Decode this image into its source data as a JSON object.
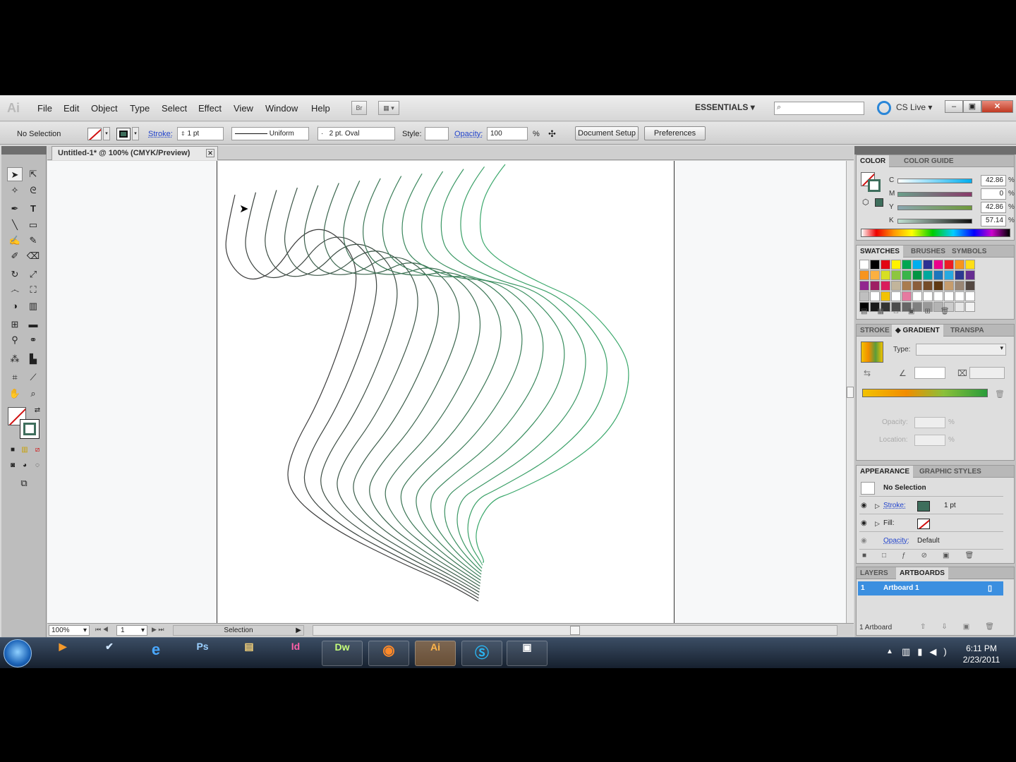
{
  "menubar": {
    "app_logo": "Ai",
    "items": [
      "File",
      "Edit",
      "Object",
      "Type",
      "Select",
      "Effect",
      "View",
      "Window",
      "Help"
    ],
    "bridge_label": "Br",
    "workspace": "ESSENTIALS",
    "cs_live": "CS Live"
  },
  "controlbar": {
    "selection": "No Selection",
    "stroke_label": "Stroke:",
    "stroke_weight": "1 pt",
    "profile": "Uniform",
    "brush": "2 pt. Oval",
    "style_label": "Style:",
    "opacity_label": "Opacity:",
    "opacity_value": "100",
    "opacity_unit": "%",
    "document_setup": "Document Setup",
    "preferences": "Preferences"
  },
  "document": {
    "tab_title": "Untitled-1* @ 100% (CMYK/Preview)",
    "zoom": "100%",
    "artboard_num": "1",
    "status": "Selection"
  },
  "color_panel": {
    "tabs": [
      "COLOR",
      "COLOR GUIDE"
    ],
    "channels": [
      {
        "label": "C",
        "value": "42.86",
        "unit": "%"
      },
      {
        "label": "M",
        "value": "0",
        "unit": "%"
      },
      {
        "label": "Y",
        "value": "42.86",
        "unit": "%"
      },
      {
        "label": "K",
        "value": "57.14",
        "unit": "%"
      }
    ]
  },
  "swatches_panel": {
    "tabs": [
      "SWATCHES",
      "BRUSHES",
      "SYMBOLS"
    ]
  },
  "gradient_panel": {
    "tabs": [
      "STROKE",
      "GRADIENT",
      "TRANSPA"
    ],
    "type_label": "Type:",
    "opacity_label": "Opacity:",
    "location_label": "Location:",
    "percent": "%"
  },
  "appearance_panel": {
    "tabs": [
      "APPEARANCE",
      "GRAPHIC STYLES"
    ],
    "header": "No Selection",
    "stroke_label": "Stroke:",
    "stroke_value": "1 pt",
    "fill_label": "Fill:",
    "opacity_label": "Opacity:",
    "opacity_value": "Default"
  },
  "layers_panel": {
    "tabs": [
      "LAYERS",
      "ARTBOARDS"
    ],
    "row_num": "1",
    "row_name": "Artboard 1",
    "footer": "1 Artboard"
  },
  "taskbar": {
    "apps": [
      "Ps",
      "Id",
      "Dw",
      "Ai"
    ],
    "time": "6:11 PM",
    "date": "2/23/2011"
  },
  "colors": {
    "accent_green": "#3aa86b",
    "stroke_swatch": "#3e6e5c",
    "selection_blue": "#3b8fe0"
  }
}
